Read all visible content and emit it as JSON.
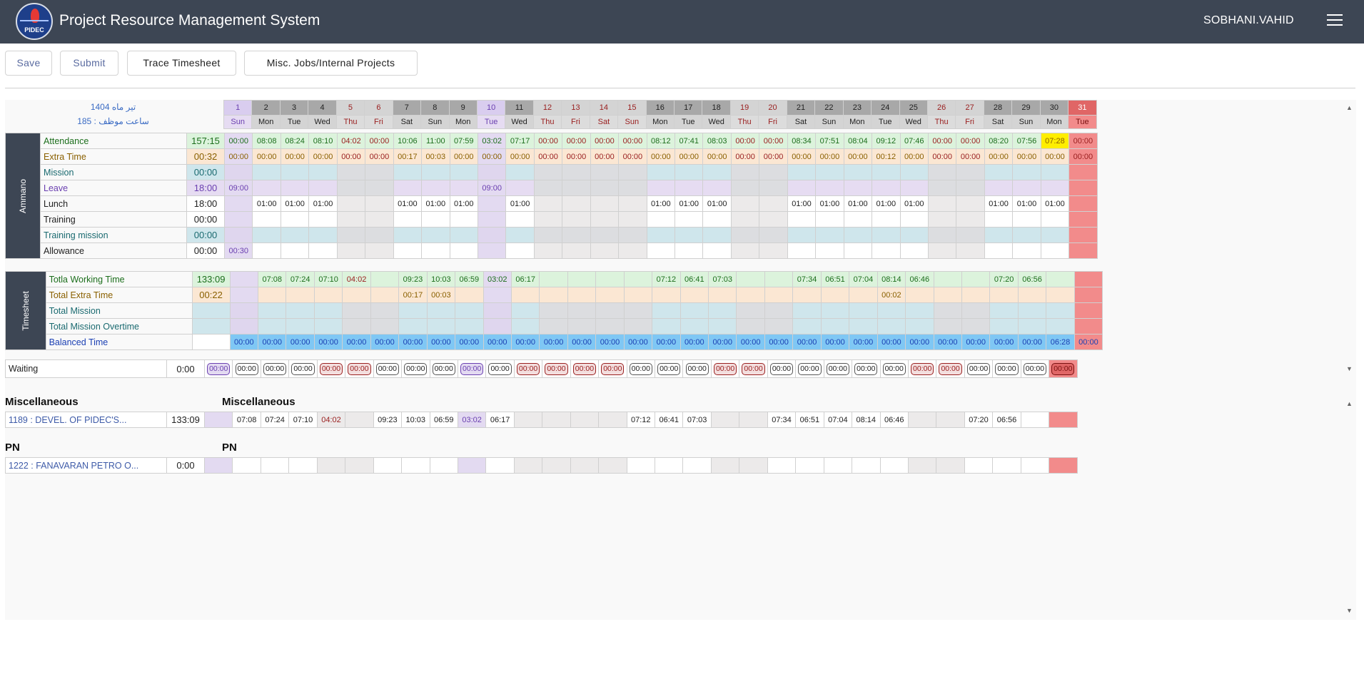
{
  "header": {
    "logo_text": "PIDEC",
    "title": "Project Resource Management System",
    "user": "SOBHANI.VAHID",
    "menu_icon": "hamburger-menu-icon"
  },
  "toolbar": {
    "save": "Save",
    "submit": "Submit",
    "trace": "Trace Timesheet",
    "misc": "Misc. Jobs/Internal Projects"
  },
  "summary": {
    "month": "تیر ماه 1404",
    "duty_hours": "ساعت موظف : 185"
  },
  "days": [
    {
      "n": "1",
      "w": "Sun",
      "t": "sel"
    },
    {
      "n": "2",
      "w": "Mon",
      "t": "wd"
    },
    {
      "n": "3",
      "w": "Tue",
      "t": "wd"
    },
    {
      "n": "4",
      "w": "Wed",
      "t": "wd"
    },
    {
      "n": "5",
      "w": "Thu",
      "t": "we"
    },
    {
      "n": "6",
      "w": "Fri",
      "t": "we"
    },
    {
      "n": "7",
      "w": "Sat",
      "t": "wd"
    },
    {
      "n": "8",
      "w": "Sun",
      "t": "wd"
    },
    {
      "n": "9",
      "w": "Mon",
      "t": "wd"
    },
    {
      "n": "10",
      "w": "Tue",
      "t": "sel"
    },
    {
      "n": "11",
      "w": "Wed",
      "t": "wd"
    },
    {
      "n": "12",
      "w": "Thu",
      "t": "we"
    },
    {
      "n": "13",
      "w": "Fri",
      "t": "we"
    },
    {
      "n": "14",
      "w": "Sat",
      "t": "we"
    },
    {
      "n": "15",
      "w": "Sun",
      "t": "we"
    },
    {
      "n": "16",
      "w": "Mon",
      "t": "wd"
    },
    {
      "n": "17",
      "w": "Tue",
      "t": "wd"
    },
    {
      "n": "18",
      "w": "Wed",
      "t": "wd"
    },
    {
      "n": "19",
      "w": "Thu",
      "t": "we"
    },
    {
      "n": "20",
      "w": "Fri",
      "t": "we"
    },
    {
      "n": "21",
      "w": "Sat",
      "t": "wd"
    },
    {
      "n": "22",
      "w": "Sun",
      "t": "wd"
    },
    {
      "n": "23",
      "w": "Mon",
      "t": "wd"
    },
    {
      "n": "24",
      "w": "Tue",
      "t": "wd"
    },
    {
      "n": "25",
      "w": "Wed",
      "t": "wd"
    },
    {
      "n": "26",
      "w": "Thu",
      "t": "we"
    },
    {
      "n": "27",
      "w": "Fri",
      "t": "we"
    },
    {
      "n": "28",
      "w": "Sat",
      "t": "wd"
    },
    {
      "n": "29",
      "w": "Sun",
      "t": "wd"
    },
    {
      "n": "30",
      "w": "Mon",
      "t": "wd"
    },
    {
      "n": "31",
      "w": "Tue",
      "t": "today"
    }
  ],
  "ammano": {
    "title": "Ammano",
    "rows": [
      {
        "label": "Attendance",
        "total": "157:15",
        "kind": "attendance",
        "vals": [
          "00:00",
          "08:08",
          "08:24",
          "08:10",
          "04:02",
          "00:00",
          "10:06",
          "11:00",
          "07:59",
          "03:02",
          "07:17",
          "00:00",
          "00:00",
          "00:00",
          "00:00",
          "08:12",
          "07:41",
          "08:03",
          "00:00",
          "00:00",
          "08:34",
          "07:51",
          "08:04",
          "09:12",
          "07:46",
          "00:00",
          "00:00",
          "08:20",
          "07:56",
          "07:28",
          "00:00"
        ]
      },
      {
        "label": "Extra Time",
        "total": "00:32",
        "kind": "extra",
        "vals": [
          "00:00",
          "00:00",
          "00:00",
          "00:00",
          "00:00",
          "00:00",
          "00:17",
          "00:03",
          "00:00",
          "00:00",
          "00:00",
          "00:00",
          "00:00",
          "00:00",
          "00:00",
          "00:00",
          "00:00",
          "00:00",
          "00:00",
          "00:00",
          "00:00",
          "00:00",
          "00:00",
          "00:12",
          "00:00",
          "00:00",
          "00:00",
          "00:00",
          "00:00",
          "00:00",
          "00:00"
        ]
      },
      {
        "label": "Mission",
        "total": "00:00",
        "kind": "mission",
        "vals": []
      },
      {
        "label": "Leave",
        "total": "18:00",
        "kind": "leave",
        "vals": [
          "09:00",
          "",
          "",
          "",
          "",
          "",
          "",
          "",
          "",
          "09:00",
          "",
          "",
          "",
          "",
          "",
          "",
          "",
          "",
          "",
          "",
          "",
          "",
          "",
          "",
          "",
          "",
          "",
          "",
          "",
          "",
          ""
        ]
      },
      {
        "label": "Lunch",
        "total": "18:00",
        "kind": "plain",
        "vals": [
          "",
          "01:00",
          "01:00",
          "01:00",
          "",
          "",
          "01:00",
          "01:00",
          "01:00",
          "",
          "01:00",
          "",
          "",
          "",
          "",
          "01:00",
          "01:00",
          "01:00",
          "",
          "",
          "01:00",
          "01:00",
          "01:00",
          "01:00",
          "01:00",
          "",
          "",
          "01:00",
          "01:00",
          "01:00",
          ""
        ]
      },
      {
        "label": "Training",
        "total": "00:00",
        "kind": "plain",
        "vals": []
      },
      {
        "label": "Training mission",
        "total": "00:00",
        "kind": "mission",
        "vals": []
      },
      {
        "label": "Allowance",
        "total": "00:00",
        "kind": "plain",
        "vals": [
          "00:30"
        ]
      }
    ]
  },
  "timesheet": {
    "title": "Timesheet",
    "rows": [
      {
        "label": "Totla Working Time",
        "total": "133:09",
        "kind": "attendance",
        "vals": [
          "",
          "07:08",
          "07:24",
          "07:10",
          "04:02",
          "",
          "09:23",
          "10:03",
          "06:59",
          "03:02",
          "06:17",
          "",
          "",
          "",
          "",
          "07:12",
          "06:41",
          "07:03",
          "",
          "",
          "07:34",
          "06:51",
          "07:04",
          "08:14",
          "06:46",
          "",
          "",
          "07:20",
          "06:56",
          "",
          ""
        ]
      },
      {
        "label": "Total Extra Time",
        "total": "00:22",
        "kind": "extra",
        "vals": [
          "",
          "",
          "",
          "",
          "",
          "",
          "00:17",
          "00:03",
          "",
          "",
          "",
          "",
          "",
          "",
          "",
          "",
          "",
          "",
          "",
          "",
          "",
          "",
          "",
          "00:02",
          "",
          "",
          "",
          "",
          "",
          "",
          ""
        ]
      },
      {
        "label": "Total Mission",
        "total": "",
        "kind": "mission",
        "vals": []
      },
      {
        "label": "Total Mission Overtime",
        "total": "",
        "kind": "mission",
        "vals": []
      },
      {
        "label": "Balanced Time",
        "total": "",
        "kind": "balanced",
        "vals": [
          "00:00",
          "00:00",
          "00:00",
          "00:00",
          "00:00",
          "00:00",
          "00:00",
          "00:00",
          "00:00",
          "00:00",
          "00:00",
          "00:00",
          "00:00",
          "00:00",
          "00:00",
          "00:00",
          "00:00",
          "00:00",
          "00:00",
          "00:00",
          "00:00",
          "00:00",
          "00:00",
          "00:00",
          "00:00",
          "00:00",
          "00:00",
          "00:00",
          "00:00",
          "06:28",
          "00:00"
        ]
      }
    ]
  },
  "waiting": {
    "label": "Waiting",
    "total": "0:00",
    "vals": [
      "00:00",
      "00:00",
      "00:00",
      "00:00",
      "00:00",
      "00:00",
      "00:00",
      "00:00",
      "00:00",
      "00:00",
      "00:00",
      "00:00",
      "00:00",
      "00:00",
      "00:00",
      "00:00",
      "00:00",
      "00:00",
      "00:00",
      "00:00",
      "00:00",
      "00:00",
      "00:00",
      "00:00",
      "00:00",
      "00:00",
      "00:00",
      "00:00",
      "00:00",
      "00:00",
      "00:00"
    ]
  },
  "projects": [
    {
      "section": "Miscellaneous",
      "label": "1189 : DEVEL. OF PIDEC'S...",
      "total": "133:09",
      "vals": [
        "",
        "07:08",
        "07:24",
        "07:10",
        "04:02",
        "",
        "09:23",
        "10:03",
        "06:59",
        "03:02",
        "06:17",
        "",
        "",
        "",
        "",
        "07:12",
        "06:41",
        "07:03",
        "",
        "",
        "07:34",
        "06:51",
        "07:04",
        "08:14",
        "06:46",
        "",
        "",
        "07:20",
        "06:56",
        "",
        ""
      ]
    },
    {
      "section": "PN",
      "label": "1222 : FANAVARAN PETRO O...",
      "total": "0:00",
      "vals": []
    }
  ],
  "colors": {
    "header": "#3d4654",
    "accent_purple": "#7a57c8",
    "weekend_red": "#9a2020",
    "today": "#f28b8b",
    "attendance_bg": "#dcf3dc",
    "extra_bg": "#fbe7d3",
    "mission_bg": "#cfe6ec",
    "leave_bg": "#e6dcf2",
    "balanced_bg": "#7fc7f4",
    "highlight_yellow": "#ffee00"
  }
}
